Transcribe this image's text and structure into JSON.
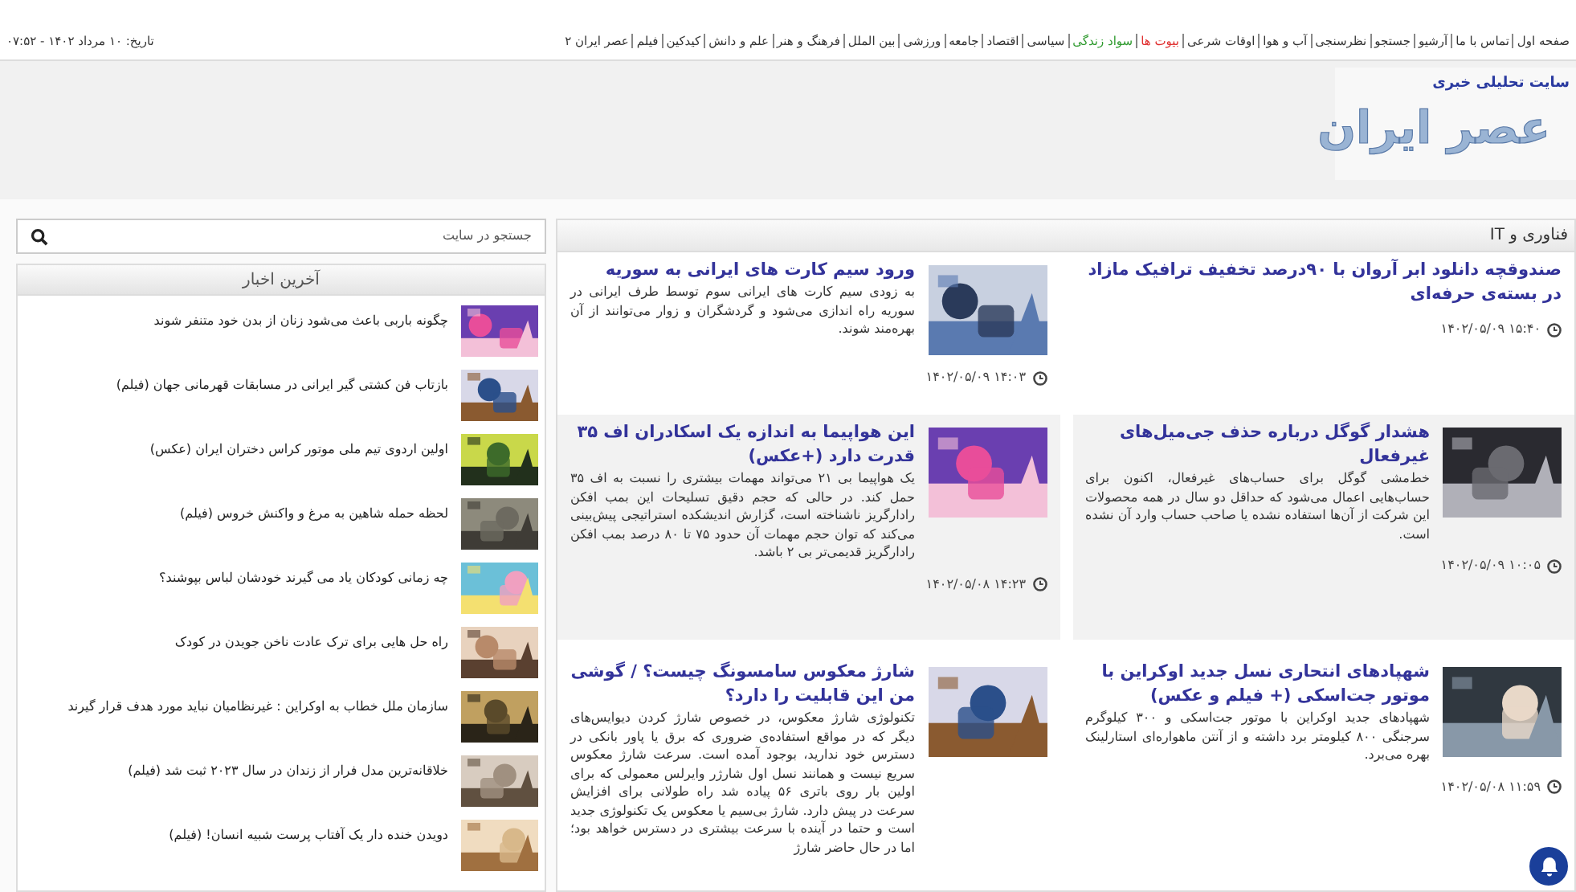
{
  "top_bar": {
    "date": "تاریخ: ۱۰ مرداد ۱۴۰۲ - ۰۷:۵۲",
    "menu": [
      {
        "label": "صفحه اول"
      },
      {
        "label": "تماس با ما"
      },
      {
        "label": "آرشیو"
      },
      {
        "label": "جستجو"
      },
      {
        "label": "نظرسنجی"
      },
      {
        "label": "آب و هوا"
      },
      {
        "label": "اوقات شرعی"
      },
      {
        "label": "بیوت ها",
        "color": "#e03030"
      },
      {
        "label": "سواد زندگی",
        "color": "#2e9a2e"
      },
      {
        "label": "سیاسی"
      },
      {
        "label": "اقتصاد"
      },
      {
        "label": "جامعه"
      },
      {
        "label": "ورزشی"
      },
      {
        "label": "بین الملل"
      },
      {
        "label": "فرهنگ و هنر"
      },
      {
        "label": "علم و دانش"
      },
      {
        "label": "کیدکین"
      },
      {
        "label": "فیلم"
      },
      {
        "label": "عصر ایران ۲"
      }
    ]
  },
  "header": {
    "tagline": "سایت تحلیلی خبری",
    "logo": "عصر ایران"
  },
  "section": {
    "title": "فناوری و IT",
    "columns": [
      [
        {
          "title": "صندوقچه دانلود ابر آروان با ۹۰درصد تخفیف ترافیک مازاد در بسته‌ی حرفه‌ای",
          "date": "۱۵:۴۰ ۱۴۰۲/۰۵/۰۹"
        },
        {
          "kind": "picture",
          "title": "هشدار گوگل درباره حذف جی‌میل‌های غیرفعال",
          "summary": "خط‌مشی گوگل برای حساب‌های غیرفعال، اکنون برای حساب‌هایی اعمال می‌شود که حداقل دو سال در همه محصولات این شرکت از آن‌ها استفاده نشده یا صاحب حساب وارد آن نشده است.",
          "date": "۱۰:۰۵ ۱۴۰۲/۰۵/۰۹"
        },
        {
          "kind": "picture",
          "title": "شهپادهای انتحاری نسل جدید اوکراین با موتور جت‌اسکی (+ فیلم و عکس)",
          "summary": "شهپادهای جدید اوکراین با موتور جت‌اسکی و ۳۰۰ کیلوگرم سرجنگی ۸۰۰ کیلومتر برد داشته و از آنتن ماهواره‌ای استارلینک بهره می‌برد.",
          "date": "۱۱:۵۹ ۱۴۰۲/۰۵/۰۸"
        }
      ],
      [
        {
          "kind": "picture",
          "title": "ورود سیم کارت های ایرانی به سوریه",
          "summary": "به زودی سیم کارت های ایرانی سوم توسط طرف ایرانی در سوریه راه اندازی می‌شود و گردشگران و زوار می‌توانند از آن بهره‌مند شوند.",
          "date": "۱۴:۰۳ ۱۴۰۲/۰۵/۰۹"
        },
        {
          "kind": "picture",
          "title": "این هواپیما به اندازه یک اسکادران اف ۳۵ قدرت دارد (+عکس)",
          "summary": "یک هواپیما بی ۲۱ می‌تواند مهمات بیشتری را نسبت به اف ۳۵ حمل کند. در حالی که حجم دقیق تسلیحات این بمب افکن رادارگریز ناشناخته است، گزارش اندیشکده استراتیجی پیش‌بینی می‌کند که توان حجم مهمات آن حدود ۷۵ تا ۸۰ درصد بمب افکن رادارگریز قدیمی‌تر بی ۲ باشد.",
          "date": "۱۴:۲۳ ۱۴۰۲/۰۵/۰۸"
        },
        {
          "kind": "picture",
          "title": "شارژ معکوس سامسونگ چیست؟ / گوشی من این قابلیت را دارد؟",
          "summary": "تکنولوژی شارژ معکوس، در خصوص شارژ کردن دیوایس‌های دیگر که در مواقع استفاده‌ی ضروری که برق یا پاور بانکی در دسترس خود ندارید، بوجود آمده است. سرعت شارژ معکوس سریع نیست و همانند نسل اول شارژر وایرلس معمولی که برای اولین بار روی باتری ۵۶ پیاده شد راه طولانی برای افزایش سرعت در پیش دارد. شارژ بی‌سیم یا معکوس یک تکنولوژی جدید است و حتما در آینده با سرعت بیشتری در دسترس خواهد بود؛ اما در حال حاضر شارژ"
        }
      ]
    ]
  },
  "sidebar": {
    "search": {
      "placeholder": "جستجو در سایت"
    },
    "latest": {
      "title": "آخرین اخبار",
      "items": [
        {
          "title": "چگونه باربی باعث می‌شود زنان از بدن خود متنفر شوند"
        },
        {
          "title": "بازتاب فن کشتی گیر ایرانی در مسابقات قهرمانی جهان (فیلم)"
        },
        {
          "title": "اولین اردوی تیم ملی موتور کراس دختران ایران (عکس)"
        },
        {
          "title": "لحظه حمله شاهین به مرغ و واکنش خروس (فیلم)"
        },
        {
          "title": "چه زمانی کودکان یاد می گیرند خودشان لباس بپوشند؟"
        },
        {
          "title": "راه حل هایی برای ترک عادت ناخن جویدن در کودک"
        },
        {
          "title": "سازمان ملل خطاب به اوکراین : غیرنظامیان نباید مورد هدف قرار گیرند"
        },
        {
          "title": "خلاقانه‌ترین مدل فرار از زندان در سال ۲۰۲۳ ثبت شد (فیلم)"
        },
        {
          "title": "دویدن خنده دار یک آفتاب پرست شبیه انسان! (فیلم)"
        }
      ]
    }
  }
}
